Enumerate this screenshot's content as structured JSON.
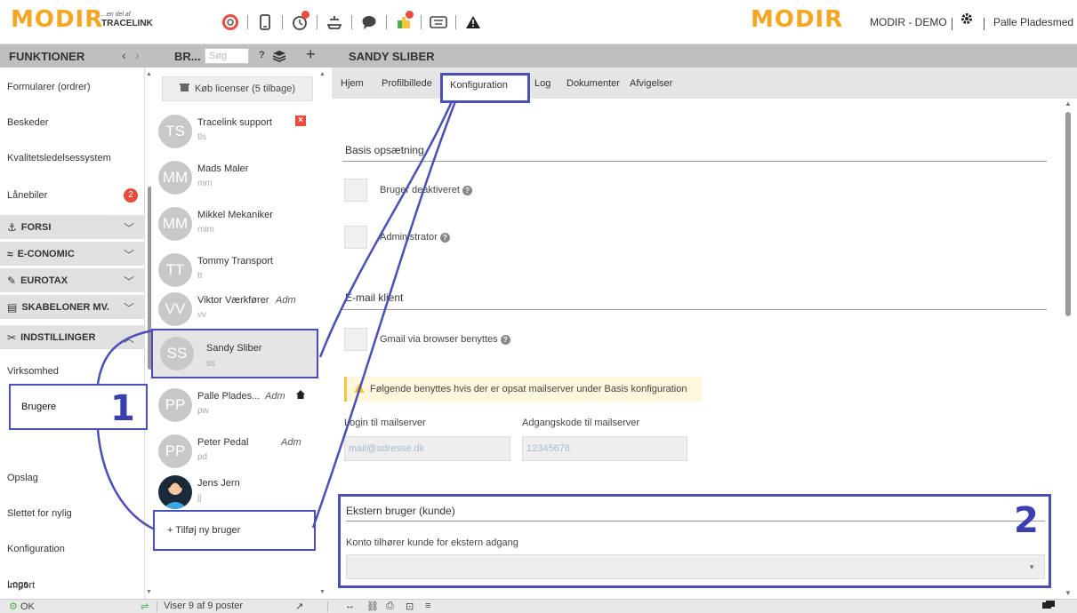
{
  "topbar": {
    "logo": "MODIR",
    "tagline_small": "...en del af",
    "tagline_brand": "TRACELINK",
    "demo_label": "MODIR - DEMO",
    "user_label": "Palle Pladesmed",
    "icons": [
      "lifebuoy-icon",
      "phone-icon",
      "timer-icon",
      "lift-icon",
      "chat-icon",
      "puzzle-icon",
      "keyboard-icon",
      "warning-icon"
    ]
  },
  "header": {
    "funktioner": "FUNKTIONER",
    "prev": "‹",
    "next": "›",
    "users_title": "BR...",
    "search_placeholder": "Søg",
    "help": "?",
    "add": "+",
    "selected_user": "SANDY SLIBER"
  },
  "nav": {
    "items_top": [
      {
        "label": "Formularer (ordrer)"
      },
      {
        "label": "Beskeder"
      },
      {
        "label": "Kvalitetsledelsessystem"
      },
      {
        "label": "Lånebiler",
        "badge": "2"
      }
    ],
    "sections": [
      {
        "label": "FORSI",
        "icon": "⚓"
      },
      {
        "label": "E-CONOMIC",
        "icon": "≈"
      },
      {
        "label": "EUROTAX",
        "icon": "✎"
      },
      {
        "label": "SKABELONER MV.",
        "icon": "▤"
      },
      {
        "label": "INDSTILLINGER",
        "icon": "✂"
      }
    ],
    "items_settings": [
      {
        "label": "Virksomhed"
      },
      {
        "label": "Brugere"
      },
      {
        "label": "Opslag"
      },
      {
        "label": "Slettet for nylig"
      },
      {
        "label": "Konfiguration"
      },
      {
        "label": "Logs"
      },
      {
        "label": "Import"
      }
    ]
  },
  "users": {
    "buy_licenses": "Køb licenser (5 tilbage)",
    "list": [
      {
        "initials": "TS",
        "name": "Tracelink support",
        "sub": "tls",
        "adm": ""
      },
      {
        "initials": "MM",
        "name": "Mads Maler",
        "sub": "mm",
        "adm": ""
      },
      {
        "initials": "MM",
        "name": "Mikkel Mekaniker",
        "sub": "mim",
        "adm": ""
      },
      {
        "initials": "TT",
        "name": "Tommy Transport",
        "sub": "tt",
        "adm": ""
      },
      {
        "initials": "VV",
        "name": "Viktor Værkfører",
        "sub": "vv",
        "adm": "Adm"
      },
      {
        "initials": "SS",
        "name": "Sandy Sliber",
        "sub": "ss",
        "adm": ""
      },
      {
        "initials": "PP",
        "name": "Palle Plades...",
        "sub": "pw",
        "adm": "Adm"
      },
      {
        "initials": "PP",
        "name": "Peter Pedal",
        "sub": "pd",
        "adm": "Adm"
      },
      {
        "initials": "",
        "name": "Jens Jern",
        "sub": "jj",
        "adm": ""
      }
    ],
    "add_user": "+ Tilføj ny bruger"
  },
  "tabs": [
    {
      "label": "Hjem"
    },
    {
      "label": "Profilbillede"
    },
    {
      "label": "Konfiguration"
    },
    {
      "label": "Log"
    },
    {
      "label": "Dokumenter"
    },
    {
      "label": "Afvigelser"
    }
  ],
  "config": {
    "basis_title": "Basis opsætning",
    "deactivated_label": "Bruger deaktiveret",
    "admin_label": "Administrator",
    "email_title": "E-mail klient",
    "gmail_label": "Gmail via browser benyttes",
    "warning_text": "Følgende benyttes hvis der er opsat mailserver under Basis konfiguration",
    "login_label": "Login til mailserver",
    "login_placeholder": "mail@adresse.dk",
    "password_label": "Adgangskode til mailserver",
    "password_placeholder": "12345678",
    "ext_title": "Ekstern bruger (kunde)",
    "ext_label": "Konto tilhører kunde for ekstern adgang"
  },
  "annotations": {
    "step1": "1",
    "step2": "2"
  },
  "bottombar": {
    "status": "OK",
    "count": "Viser 9 af 9 poster"
  },
  "colors": {
    "logo_orange": "#f5a623",
    "annotation_blue": "#4b4fb8",
    "badge_red": "#e74c3c"
  }
}
